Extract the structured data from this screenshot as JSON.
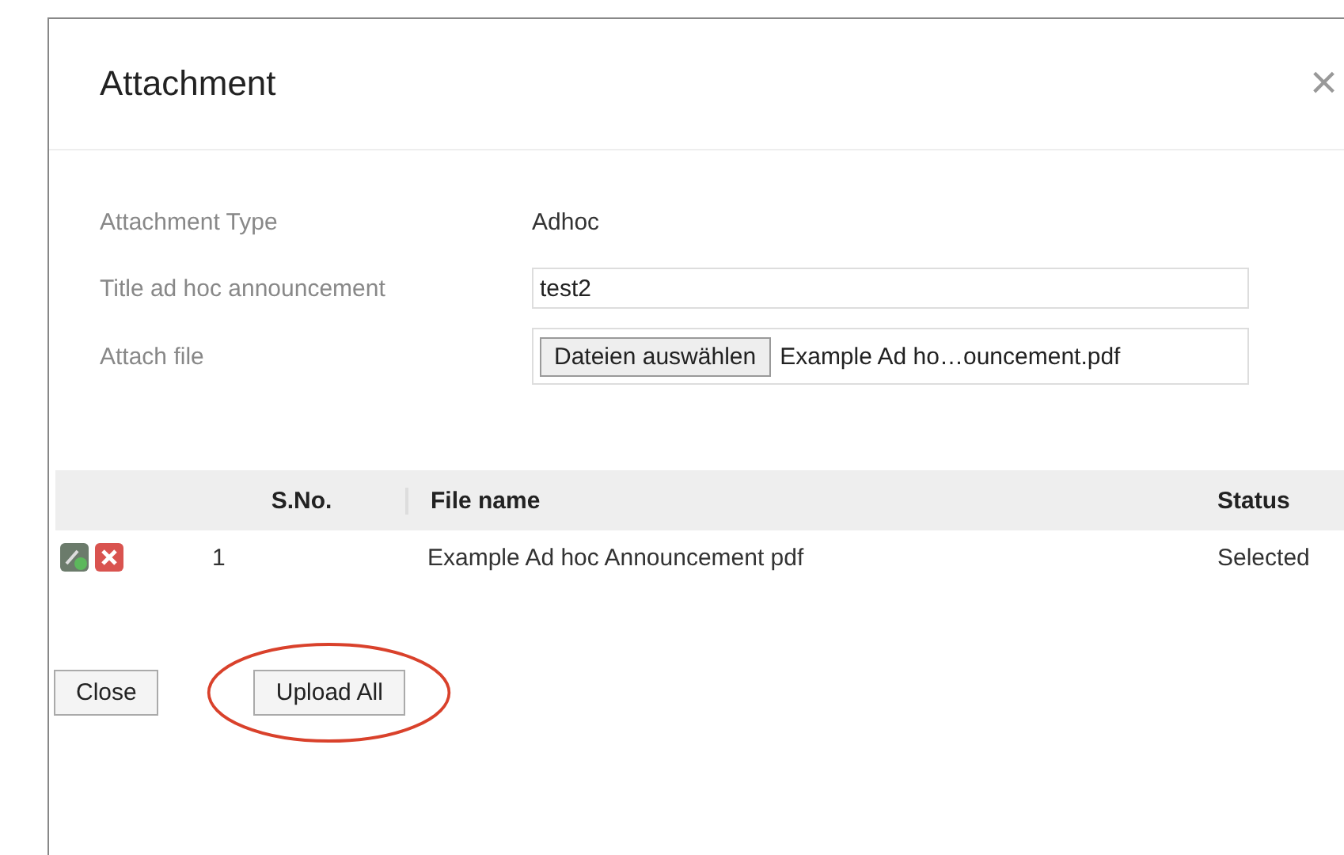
{
  "dialog": {
    "title": "Attachment",
    "close": "×"
  },
  "form": [
    {
      "label": "Attachment Type",
      "kind": "text",
      "value": "Adhoc"
    },
    {
      "label": "Title ad hoc announcement",
      "kind": "input",
      "value": "test2"
    },
    {
      "label": "Attach file",
      "kind": "file",
      "button": "Dateien auswählen",
      "value": "Example Ad ho…ouncement.pdf"
    }
  ],
  "table": {
    "columns": [
      "S.No.",
      "File name",
      "Status"
    ],
    "rows": [
      {
        "sno": "1",
        "file_name": "Example Ad hoc Announcement pdf",
        "status": "Selected"
      }
    ]
  },
  "buttons": [
    {
      "label": "Close",
      "highlighted": false
    },
    {
      "label": "Upload All",
      "highlighted": true
    }
  ]
}
